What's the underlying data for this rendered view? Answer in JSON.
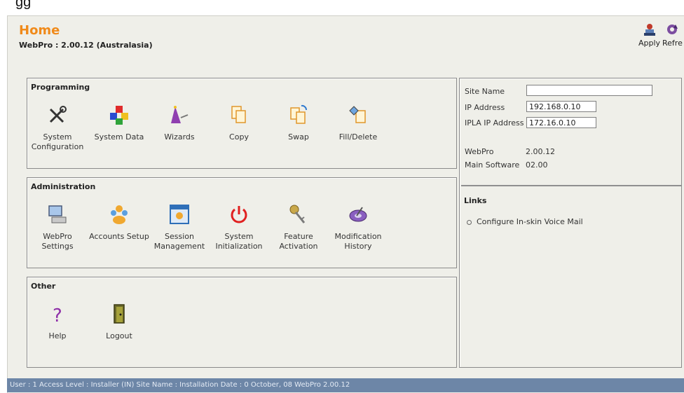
{
  "header_fragment": "gg",
  "page": {
    "title": "Home",
    "subtitle": "WebPro : 2.00.12 (Australasia)"
  },
  "toolbar": {
    "apply_label": "Apply",
    "refresh_label": "Refre"
  },
  "programming": {
    "title": "Programming",
    "items": [
      {
        "label": "System Configuration",
        "icon": "tools-icon"
      },
      {
        "label": "System Data",
        "icon": "cubes-icon"
      },
      {
        "label": "Wizards",
        "icon": "wizard-icon"
      },
      {
        "label": "Copy",
        "icon": "copy-icon"
      },
      {
        "label": "Swap",
        "icon": "swap-icon"
      },
      {
        "label": "Fill/Delete",
        "icon": "fill-delete-icon"
      }
    ]
  },
  "administration": {
    "title": "Administration",
    "items": [
      {
        "label": "WebPro Settings",
        "icon": "computer-icon"
      },
      {
        "label": "Accounts Setup",
        "icon": "users-icon"
      },
      {
        "label": "Session Management",
        "icon": "session-icon"
      },
      {
        "label": "System Initialization",
        "icon": "power-icon"
      },
      {
        "label": "Feature Activation",
        "icon": "keys-icon"
      },
      {
        "label": "Modification History",
        "icon": "history-icon"
      }
    ]
  },
  "other": {
    "title": "Other",
    "items": [
      {
        "label": "Help",
        "icon": "help-icon"
      },
      {
        "label": "Logout",
        "icon": "logout-icon"
      }
    ]
  },
  "site": {
    "site_name_label": "Site Name",
    "site_name_value": "",
    "ip_label": "IP Address",
    "ip_value": "192.168.0.10",
    "ipla_label": "IPLA IP Address",
    "ipla_value": "172.16.0.10",
    "webpro_label": "WebPro",
    "webpro_value": "2.00.12",
    "main_software_label": "Main Software",
    "main_software_value": "02.00"
  },
  "links": {
    "title": "Links",
    "items": [
      "Configure In-skin Voice Mail"
    ]
  },
  "status_bar": "User : 1  Access Level : Installer (IN)  Site Name :  Installation Date : 0 October, 08  WebPro 2.00.12",
  "colors": {
    "title": "#f08a1a",
    "background": "#efefe9",
    "status_bar": "#6d86a7"
  }
}
